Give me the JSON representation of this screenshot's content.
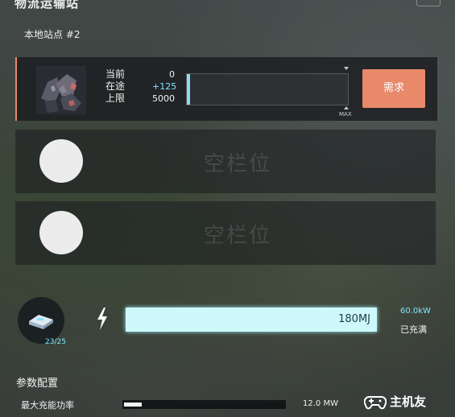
{
  "window": {
    "title": "物流运输站",
    "subtitle": "本地站点 #2"
  },
  "slots": [
    {
      "labels": {
        "current": "当前",
        "in_transit": "在途",
        "limit": "上限"
      },
      "values": {
        "current": "0",
        "in_transit": "+125",
        "limit": "5000"
      },
      "fill_fraction": 0.02,
      "max_label": "MAX",
      "mode_button": "需求",
      "accent_color": "#e8896a"
    },
    {
      "empty_label": "空栏位"
    },
    {
      "empty_label": "空栏位"
    }
  ],
  "energy": {
    "drone_count": "23/25",
    "stored": "180MJ",
    "stored_fraction": 1.0,
    "charge_power": "60.0kW",
    "status": "已充满",
    "bar_color": "#cff8fb"
  },
  "params": {
    "title": "参数配置",
    "max_charge_label": "最大充能功率",
    "max_charge_value": "12.0 MW",
    "max_charge_fraction": 0.11
  },
  "watermark": "主机友"
}
